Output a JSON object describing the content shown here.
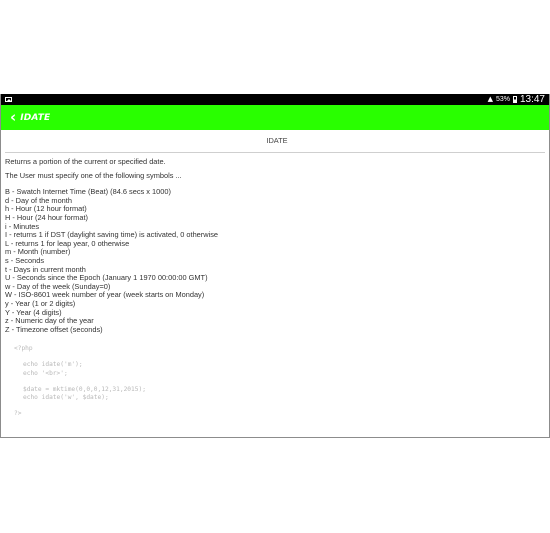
{
  "statusbar": {
    "battery_pct": "53%",
    "time": "13:47",
    "icons": [
      "image-icon",
      "wifi-icon",
      "battery-icon"
    ]
  },
  "actionbar": {
    "title": "IDATE",
    "back_icon": "chevron-left-icon",
    "color": "#29ff00"
  },
  "content": {
    "heading": "IDATE",
    "description": "Returns a portion of the current or specified date.",
    "instruction": "The User must specify one of the following symbols ...",
    "symbols": [
      "B - Swatch Internet Time (Beat) (84.6 secs x 1000)",
      "d - Day of the month",
      "h - Hour (12 hour format)",
      "H - Hour (24 hour format)",
      "i - Minutes",
      "I - returns 1 if DST (daylight saving time) is activated, 0 otherwise",
      "L - returns 1 for leap year, 0 otherwise",
      "m - Month (number)",
      "s - Seconds",
      "t - Days in current month",
      "U - Seconds since the Epoch (January 1 1970 00:00:00 GMT)",
      "w - Day of the week (Sunday=0)",
      "W - ISO-8601 week number of year (week starts on Monday)",
      "y - Year (1 or 2 digits)",
      "Y - Year (4 digits)",
      "z - Numeric day of the year",
      "Z - Timezone offset (seconds)"
    ],
    "code": {
      "open": "<?php",
      "line1": "echo idate('m');",
      "line2": "echo '<br>';",
      "line3": "$date = mktime(0,0,0,12,31,2015);",
      "line4": "echo idate('w', $date);",
      "close": "?>"
    }
  }
}
